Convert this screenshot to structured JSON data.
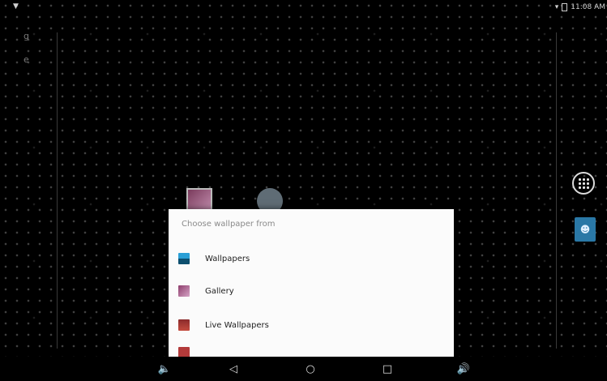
{
  "status_bar": {
    "time": "11:08 AM",
    "left_icon": "location-pin-icon",
    "right_icons": [
      "signal-icon",
      "battery-icon"
    ]
  },
  "home_screen": {
    "left_indicators": [
      "g",
      "e"
    ],
    "apps_button_icon": "apps-grid-icon",
    "account_icon": "account-icon"
  },
  "dialog": {
    "title": "Choose wallpaper from",
    "options": [
      {
        "label": "Wallpapers",
        "icon": "wallpapers-icon"
      },
      {
        "label": "Gallery",
        "icon": "gallery-icon"
      },
      {
        "label": "Live Wallpapers",
        "icon": "live-wallpapers-icon"
      }
    ]
  },
  "nav_bar": {
    "volume_down_icon": "volume-down-icon",
    "back_icon": "back-icon",
    "home_icon": "home-icon",
    "recents_icon": "recents-icon",
    "volume_up_icon": "volume-up-icon"
  },
  "colors": {
    "background": "#000000",
    "dialog_bg": "#fbfbfb",
    "accent_blue": "#2a78a6"
  }
}
